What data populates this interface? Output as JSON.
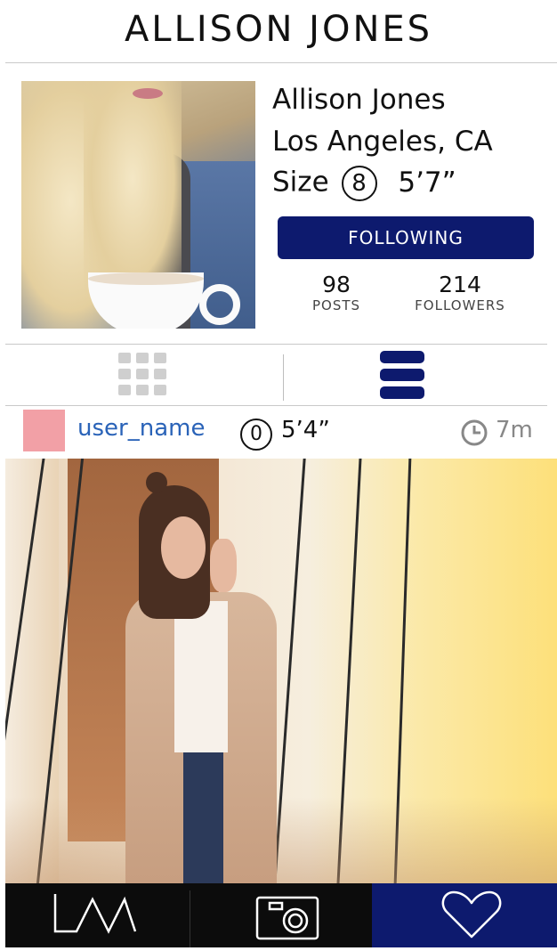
{
  "header": {
    "title": "ALLISON JONES"
  },
  "profile": {
    "name": "Allison Jones",
    "location": "Los Angeles, CA",
    "size_label": "Size",
    "size_value": "8",
    "height": "5’7”",
    "follow_button": "FOLLOWING",
    "stats": {
      "posts_count": "98",
      "posts_label": "POSTS",
      "followers_count": "214",
      "followers_label": "FOLLOWERS"
    }
  },
  "view_toggle": {
    "grid_icon": "grid-icon",
    "list_icon": "list-icon",
    "active": "list"
  },
  "post": {
    "username": "user_name",
    "size_value": "0",
    "height": "5’4”",
    "time": "7m",
    "avatar_color": "#f2a0a6"
  },
  "bottom_nav": {
    "items": [
      {
        "icon": "logo-icon",
        "label": ""
      },
      {
        "icon": "camera-icon",
        "label": ""
      },
      {
        "icon": "heart-icon",
        "label": ""
      }
    ],
    "active_index": 2
  },
  "colors": {
    "accent": "#0d1a6e",
    "username": "#2a63b8",
    "nav_background": "#0c0c0c"
  }
}
